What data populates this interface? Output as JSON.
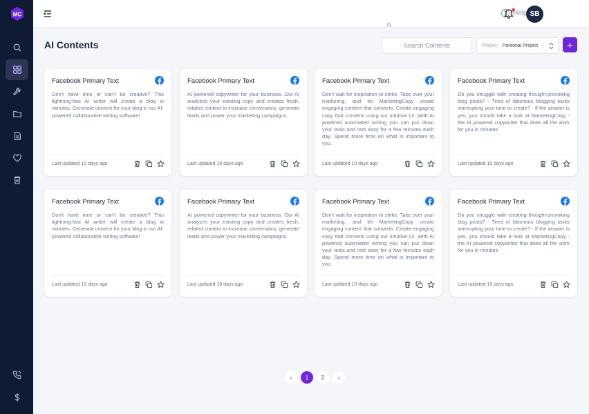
{
  "app": {
    "logo_text": "MC",
    "accent_color": "#6d28d9",
    "sidebar_color": "#0f1a33"
  },
  "sidebar": {
    "items": [
      {
        "name": "search",
        "icon": "search-icon"
      },
      {
        "name": "dashboard",
        "icon": "grid-icon",
        "active": true
      },
      {
        "name": "tools",
        "icon": "wrench-icon"
      },
      {
        "name": "folder",
        "icon": "folder-icon"
      },
      {
        "name": "documents",
        "icon": "document-icon"
      },
      {
        "name": "favorites",
        "icon": "heart-icon"
      },
      {
        "name": "trash",
        "icon": "trash-icon"
      }
    ],
    "bottom_items": [
      {
        "name": "support",
        "icon": "phone-icon"
      },
      {
        "name": "billing",
        "icon": "dollar-icon"
      }
    ]
  },
  "header": {
    "help_label": "Help",
    "avatar_initials": "SB"
  },
  "page": {
    "title": "AI Contents",
    "search_placeholder": "Search Contents",
    "project_label": "Project :",
    "project_value": "Personal Project",
    "add_label": "+"
  },
  "cards": [
    {
      "title": "Facebook Primary Text",
      "body": "Don't have time or can't be creative? This lightning-fast AI writer will create a blog in minutes. Generate content for your blog in our AI-powered collaborative writing software!",
      "updated": "Last updated 10 days ago"
    },
    {
      "title": "Facebook Primary Text",
      "body": "AI powered copywriter for your business. Our AI analyzes your existing copy and creates fresh, related content to increase conversions, generate leads and power your marketing campaigns.",
      "updated": "Last updated 10 days ago"
    },
    {
      "title": "Facebook Primary Text",
      "body": "Don't wait for inspiration to strike. Take over your marketing, and let MarketingCopy create engaging content that converts. Create engaging copy that converts using our intuitive UI. With AI powered automated writing you can put down your tools and rest easy for a few minutes each day. Spend more time on what is important to you.",
      "updated": "Last updated 10 days ago"
    },
    {
      "title": "Facebook Primary Text",
      "body": "Do you struggle with creating thought-provoking blog posts? - Tired of laborious blogging tasks interrupting your time to create? - If the answer is yes, you should take a look at MarketingCopy - the AI powered copywriter that does all the work for you in minutes`",
      "updated": "Last updated 10 days ago"
    },
    {
      "title": "Facebook Primary Text",
      "body": "Don't have time or can't be creative? This lightning-fast AI writer will create a blog in minutes. Generate content for your blog in our AI-powered collaborative writing software!",
      "updated": "Last updated 10 days ago"
    },
    {
      "title": "Facebook Primary Text",
      "body": "AI powered copywriter for your business. Our AI analyzes your existing copy and creates fresh, related content to increase conversions, generate leads and power your marketing campaigns.",
      "updated": "Last updated 10 days ago"
    },
    {
      "title": "Facebook Primary Text",
      "body": "Don't wait for inspiration to strike. Take over your marketing, and let MarketingCopy create engaging content that converts. Create engaging copy that converts using our intuitive UI. With AI powered automated writing you can put down your tools and rest easy for a few minutes each day. Spend more time on what is important to you.",
      "updated": "Last updated 10 days ago"
    },
    {
      "title": "Facebook Primary Text",
      "body": "Do you struggle with creating thought-provoking blog posts? - Tired of laborious blogging tasks interrupting your time to create? - If the answer is yes, you should take a look at MarketingCopy - the AI powered copywriter that does all the work for you in minutes`",
      "updated": "Last updated 10 days ago"
    }
  ],
  "pagination": {
    "prev": "‹",
    "pages": [
      "1",
      "2"
    ],
    "current": "1",
    "next": "›"
  }
}
